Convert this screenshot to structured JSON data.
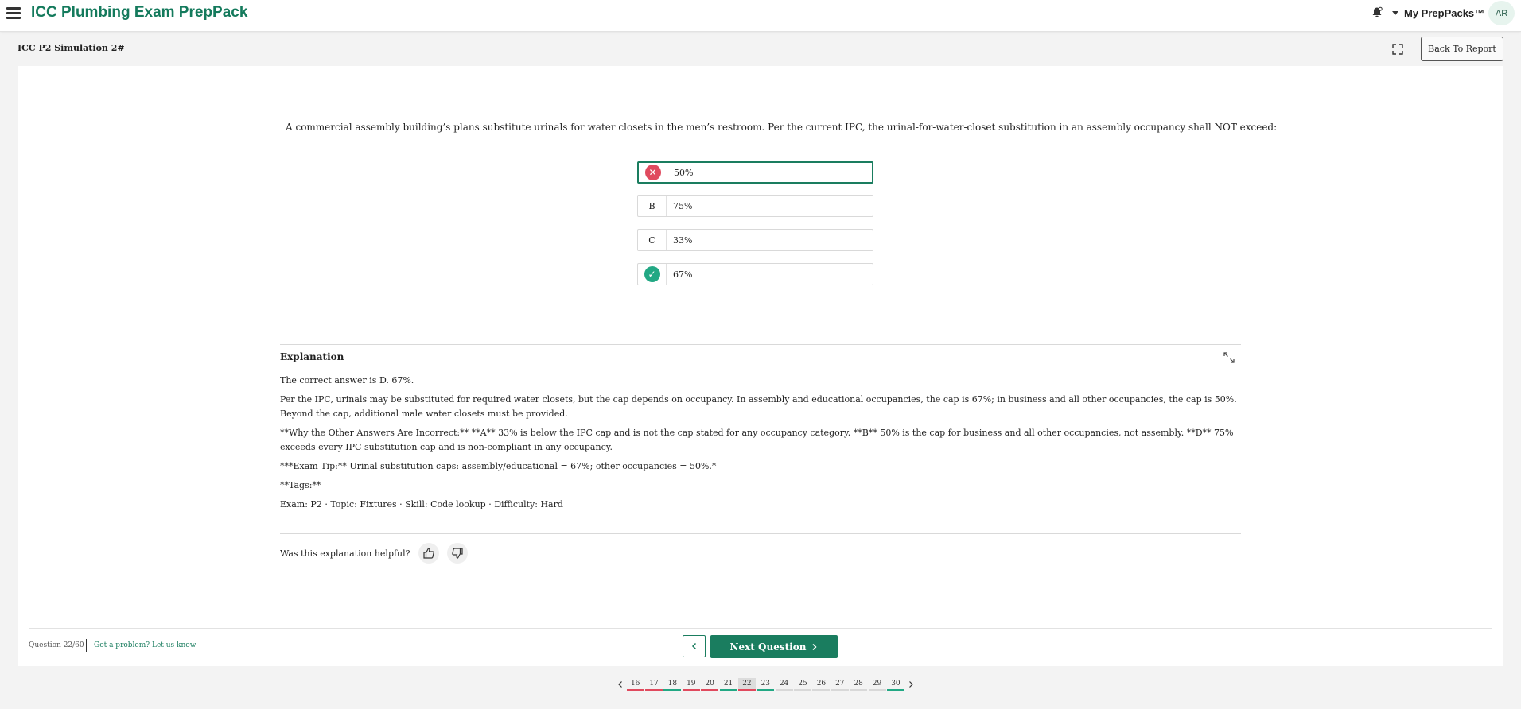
{
  "header": {
    "brand": "ICC Plumbing Exam PrepPack",
    "menu_label": "My PrepPacks™",
    "avatar_initials": "AR",
    "icons": [
      "hamburger-icon",
      "bell-icon",
      "caret-down-icon"
    ]
  },
  "subheader": {
    "title": "ICC P2 Simulation 2#",
    "back_label": "Back To Report",
    "fullscreen_icon": "fullscreen-icon"
  },
  "question": {
    "text": "A commercial assembly building’s plans substitute urinals for water closets in the men’s restroom. Per the current IPC, the urinal-for-water-closet substitution in an assembly occupancy shall NOT exceed:",
    "options": [
      {
        "marker": "✕",
        "text": "50%",
        "state": "wrong-selected"
      },
      {
        "marker": "B",
        "text": "75%",
        "state": "neutral"
      },
      {
        "marker": "C",
        "text": "33%",
        "state": "neutral"
      },
      {
        "marker": "✓",
        "text": "67%",
        "state": "correct"
      }
    ]
  },
  "explanation": {
    "title": "Explanation",
    "paragraphs": [
      "The correct answer is D. 67%.",
      "Per the IPC, urinals may be substituted for required water closets, but the cap depends on occupancy. In assembly and educational occupancies, the cap is 67%; in business and all other occupancies, the cap is 50%. Beyond the cap, additional male water closets must be provided.",
      "**Why the Other Answers Are Incorrect:** **A** 33% is below the IPC cap and is not the cap stated for any occupancy category. **B** 50% is the cap for business and all other occupancies, not assembly. **D** 75% exceeds every IPC substitution cap and is non-compliant in any occupancy.",
      "***Exam Tip:** Urinal substitution caps: assembly/educational = 67%; other occupancies = 50%.*",
      "**Tags:**",
      "Exam: P2 · Topic: Fixtures · Skill: Code lookup · Difficulty: Hard"
    ],
    "helpful_label": "Was this explanation helpful?",
    "icons": [
      "expand-icon",
      "thumbs-up-icon",
      "thumbs-down-icon"
    ]
  },
  "footer": {
    "question_count": "Question 22/60",
    "problem_link": "Got a problem? Let us know",
    "next_label": "Next Question"
  },
  "pagination": {
    "current": "22",
    "pages": [
      {
        "num": "16",
        "status": "wrong"
      },
      {
        "num": "17",
        "status": "wrong"
      },
      {
        "num": "18",
        "status": "right"
      },
      {
        "num": "19",
        "status": "wrong"
      },
      {
        "num": "20",
        "status": "wrong"
      },
      {
        "num": "21",
        "status": "right"
      },
      {
        "num": "22",
        "status": "wrong"
      },
      {
        "num": "23",
        "status": "right"
      },
      {
        "num": "24",
        "status": "none"
      },
      {
        "num": "25",
        "status": "none"
      },
      {
        "num": "26",
        "status": "none"
      },
      {
        "num": "27",
        "status": "none"
      },
      {
        "num": "28",
        "status": "none"
      },
      {
        "num": "29",
        "status": "none"
      },
      {
        "num": "30",
        "status": "right"
      }
    ]
  },
  "colors": {
    "brand": "#147a5c",
    "primary": "#1a7d5f",
    "wrong": "#e04a5e",
    "correct": "#22a884"
  }
}
